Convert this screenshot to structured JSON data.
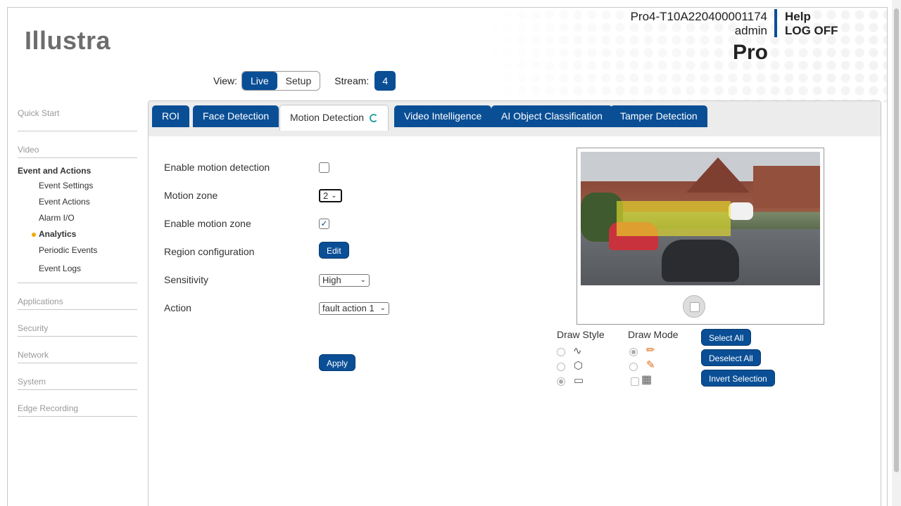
{
  "header": {
    "logo": "Illustra",
    "device_name": "Pro4-T10A220400001174",
    "user": "admin",
    "help": "Help",
    "logoff": "LOG OFF",
    "brand": "Pro"
  },
  "viewbar": {
    "view_label": "View:",
    "live": "Live",
    "setup": "Setup",
    "stream_label": "Stream:",
    "stream_value": "4"
  },
  "sidebar": {
    "quick_start": "Quick Start",
    "video": "Video",
    "event_section": "Event and Actions",
    "event_items": [
      "Event Settings",
      "Event Actions",
      "Alarm I/O",
      "Analytics",
      "Periodic Events",
      "Event Logs"
    ],
    "applications": "Applications",
    "security": "Security",
    "network": "Network",
    "system": "System",
    "edge_recording": "Edge Recording"
  },
  "tabs": [
    "ROI",
    "Face Detection",
    "Motion Detection",
    "Video Intelligence",
    "AI Object Classification",
    "Tamper Detection"
  ],
  "form": {
    "enable_motion_detection": {
      "label": "Enable motion detection",
      "checked": false
    },
    "motion_zone": {
      "label": "Motion zone",
      "value": "2"
    },
    "enable_motion_zone": {
      "label": "Enable motion zone",
      "checked": true
    },
    "region_config": {
      "label": "Region configuration",
      "button": "Edit"
    },
    "sensitivity": {
      "label": "Sensitivity",
      "value": "High"
    },
    "action": {
      "label": "Action",
      "value": "fault action 1"
    },
    "apply": "Apply"
  },
  "draw": {
    "style_label": "Draw Style",
    "mode_label": "Draw Mode",
    "select_all": "Select All",
    "deselect_all": "Deselect All",
    "invert_selection": "Invert Selection"
  },
  "colors": {
    "accent": "#0a4f96",
    "zone_fill": "#ece628",
    "active_dot": "#f2a900"
  }
}
